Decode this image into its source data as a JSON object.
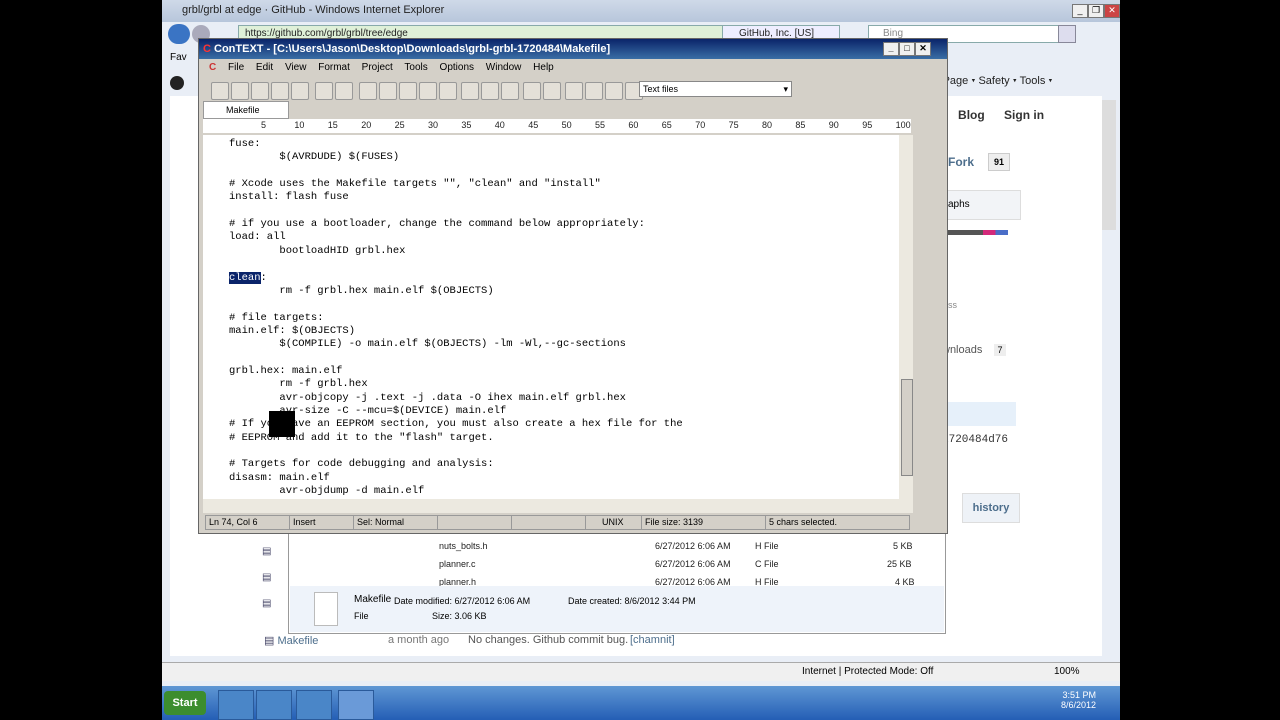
{
  "ie": {
    "title": "grbl/grbl at edge · GitHub - Windows Internet Explorer",
    "address": "https://github.com/grbl/grbl/tree/edge",
    "tab_label": "GitHub, Inc. [US]",
    "search_placeholder": "Bing",
    "favorites_label": "Fav",
    "cmd_page": "Page ▾",
    "cmd_safety": "Safety ▾",
    "cmd_tools": "Tools ▾",
    "status_zone": "Internet | Protected Mode: Off",
    "zoom": "100%"
  },
  "github": {
    "nav_blog": "Blog",
    "nav_signin": "Sign in",
    "nav_s": "s",
    "fork_label": "Fork",
    "fork_count": "91",
    "graphs": "aphs",
    "ss": "ss",
    "downloads": "wnloads",
    "downloads_count": "7",
    "commit": "1720484d76",
    "history": "history",
    "makefile_link": "Makefile",
    "makefile_age": "a month ago",
    "makefile_msg": "No changes. Github commit bug.",
    "makefile_author": "[chamnit]"
  },
  "context": {
    "title": "ConTEXT - [C:\\Users\\Jason\\Desktop\\Downloads\\grbl-grbl-1720484\\Makefile]",
    "menu": [
      "File",
      "Edit",
      "View",
      "Format",
      "Project",
      "Tools",
      "Options",
      "Window",
      "Help"
    ],
    "filetype": "Text files",
    "tab": "Makefile",
    "ruler": [
      "5",
      "10",
      "15",
      "20",
      "25",
      "30",
      "35",
      "40",
      "45",
      "50",
      "55",
      "60",
      "65",
      "70",
      "75",
      "80",
      "85",
      "90",
      "95",
      "100"
    ],
    "lines": [
      "fuse:",
      "        $(AVRDUDE) $(FUSES)",
      "",
      "# Xcode uses the Makefile targets \"\", \"clean\" and \"install\"",
      "install: flash fuse",
      "",
      "# if you use a bootloader, change the command below appropriately:",
      "load: all",
      "        bootloadHID grbl.hex",
      "",
      "clean:",
      "        rm -f grbl.hex main.elf $(OBJECTS)",
      "",
      "# file targets:",
      "main.elf: $(OBJECTS)",
      "        $(COMPILE) -o main.elf $(OBJECTS) -lm -Wl,--gc-sections",
      "",
      "grbl.hex: main.elf",
      "        rm -f grbl.hex",
      "        avr-objcopy -j .text -j .data -O ihex main.elf grbl.hex",
      "        avr-size -C --mcu=$(DEVICE) main.elf",
      "# If you have an EEPROM section, you must also create a hex file for the",
      "# EEPROM and add it to the \"flash\" target.",
      "",
      "# Targets for code debugging and analysis:",
      "disasm: main.elf",
      "        avr-objdump -d main.elf"
    ],
    "status": {
      "pos": "Ln 74, Col 6",
      "insert": "Insert",
      "sel": "Sel: Normal",
      "eol": "UNIX",
      "size": "File size: 3139",
      "selected": "5 chars selected."
    }
  },
  "explorer": {
    "files": [
      {
        "name": "nuts_bolts.h",
        "date": "6/27/2012 6:06 AM",
        "type": "H File",
        "size": "5 KB"
      },
      {
        "name": "planner.c",
        "date": "6/27/2012 6:06 AM",
        "type": "C File",
        "size": "25 KB"
      },
      {
        "name": "planner.h",
        "date": "6/27/2012 6:06 AM",
        "type": "H File",
        "size": "4 KB"
      }
    ],
    "detail_name": "Makefile",
    "detail_modified": "Date modified: 6/27/2012 6:06 AM",
    "detail_created": "Date created: 8/6/2012 3:44 PM",
    "detail_type": "File",
    "detail_size": "Size: 3.06 KB"
  },
  "taskbar": {
    "start": "Start",
    "time": "3:51 PM",
    "date": "8/6/2012"
  }
}
